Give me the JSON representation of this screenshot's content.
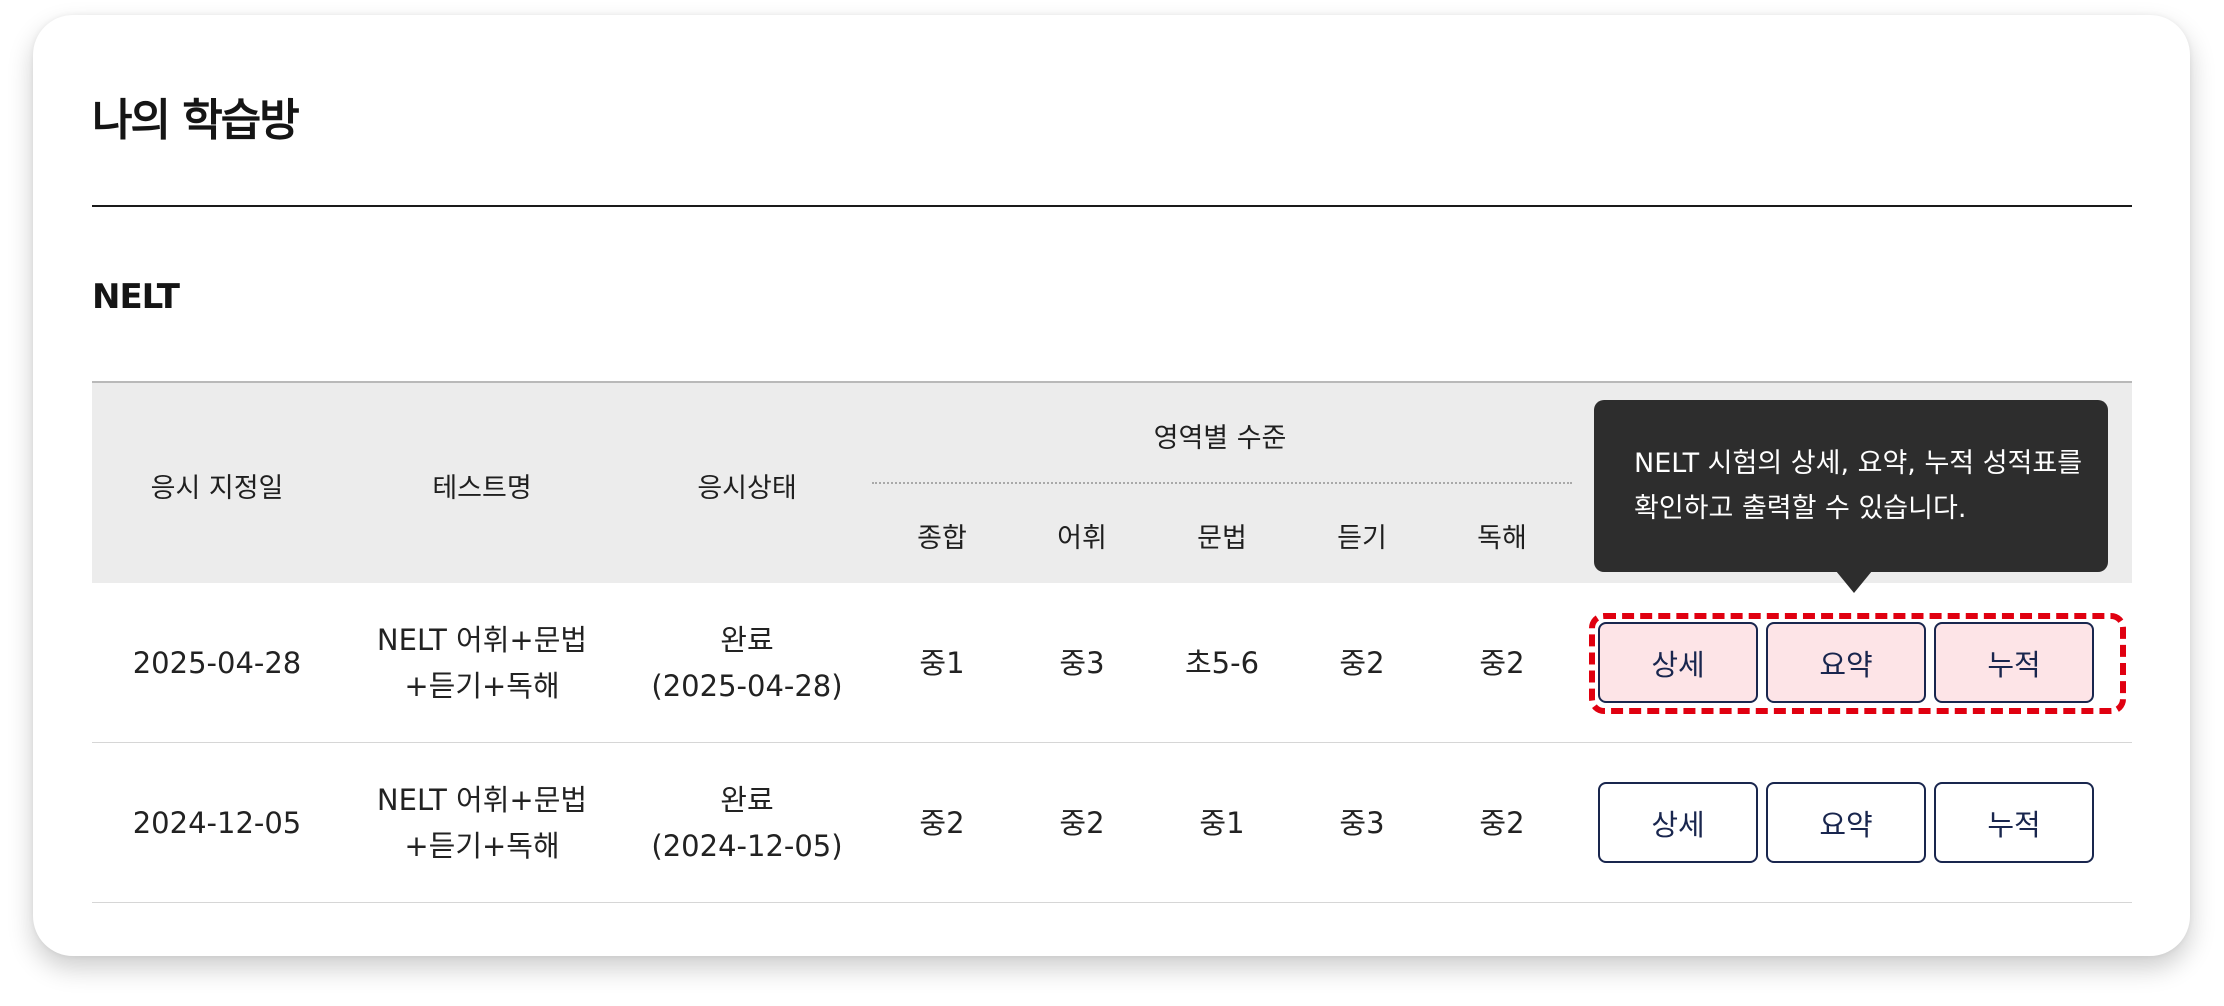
{
  "page_title": "나의 학습방",
  "section_title": "NELT",
  "table": {
    "headers": {
      "date": "응시 지정일",
      "test_name": "테스트명",
      "status": "응시상태",
      "level_group": "영역별 수준",
      "overall": "종합",
      "vocabulary": "어휘",
      "grammar": "문법",
      "listening": "듣기",
      "reading": "독해"
    },
    "rows": [
      {
        "date": "2025-04-28",
        "test_name_line1": "NELT 어휘+문법",
        "test_name_line2": "+듣기+독해",
        "status_line1": "완료",
        "status_line2": "(2025-04-28)",
        "overall": "중1",
        "vocabulary": "중3",
        "grammar": "초5-6",
        "listening": "중2",
        "reading": "중2",
        "buttons": {
          "detail": "상세",
          "summary": "요약",
          "cumulative": "누적"
        }
      },
      {
        "date": "2024-12-05",
        "test_name_line1": "NELT 어휘+문법",
        "test_name_line2": "+듣기+독해",
        "status_line1": "완료",
        "status_line2": "(2024-12-05)",
        "overall": "중2",
        "vocabulary": "중2",
        "grammar": "중1",
        "listening": "중3",
        "reading": "중2",
        "buttons": {
          "detail": "상세",
          "summary": "요약",
          "cumulative": "누적"
        }
      }
    ]
  },
  "tooltip": {
    "line1": "NELT 시험의 상세, 요약, 누적 성적표를",
    "line2": "확인하고 출력할 수 있습니다."
  },
  "colors": {
    "button_border": "#19264e",
    "highlight_outline": "#e00010",
    "highlight_fill": "#fde4e7",
    "tooltip_bg": "#2d2d2d",
    "header_bg": "#ececec"
  }
}
